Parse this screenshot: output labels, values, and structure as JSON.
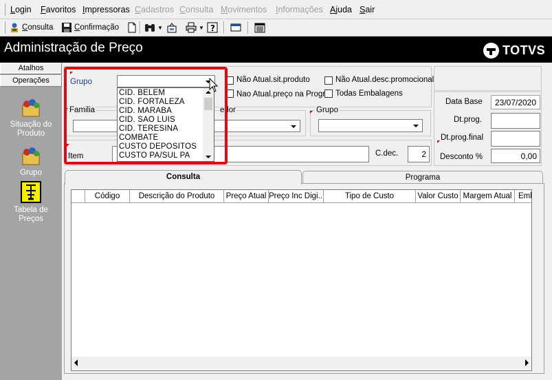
{
  "menu": {
    "items": [
      {
        "label": "Login",
        "ul": "L",
        "rest": "ogin",
        "enabled": true
      },
      {
        "label": "Favoritos",
        "ul": "F",
        "rest": "avoritos",
        "enabled": true
      },
      {
        "label": "Impressoras",
        "ul": "I",
        "rest": "mpressoras",
        "enabled": true
      },
      {
        "label": "Cadastros",
        "ul": "C",
        "rest": "adastros",
        "enabled": false
      },
      {
        "label": "Consulta",
        "ul": "C",
        "rest": "onsulta",
        "enabled": false
      },
      {
        "label": "Movimentos",
        "ul": "M",
        "rest": "ovimentos",
        "enabled": false
      },
      {
        "label": "Informações",
        "ul": "I",
        "rest": "nformações",
        "enabled": false
      },
      {
        "label": "Ajuda",
        "ul": "A",
        "rest": "juda",
        "enabled": true
      },
      {
        "label": "Sair",
        "ul": "S",
        "rest": "air",
        "enabled": true
      }
    ]
  },
  "toolbar": {
    "consulta": {
      "ul": "C",
      "rest": "onsulta"
    },
    "confirmacao": {
      "ul": "C",
      "rest": "onfirmação"
    }
  },
  "window": {
    "title": "Administração de Preço",
    "logo_text": "TOTVS"
  },
  "left_panel": {
    "atalhos": "Atalhos",
    "operacoes": "Operações",
    "items": [
      {
        "line1": "Situação do",
        "line2": "Produto"
      },
      {
        "line1": "Grupo",
        "line2": ""
      },
      {
        "line1": "Tabela de",
        "line2": "Preços"
      }
    ]
  },
  "form": {
    "grupo_label": "Grupo",
    "grupo_value": "",
    "familia_label": "Familia",
    "fornecedor_label_partial": "edor",
    "grupo2_label": "Grupo",
    "item_label": "Item",
    "cdec_label": "C.dec.",
    "cdec_value": "2",
    "checkboxes": [
      {
        "label": "Não Atual.sit.produto",
        "checked": false
      },
      {
        "label": "Nao Atual.preço na Progr.",
        "checked": false
      },
      {
        "label": "Não Atual.desc.promocional",
        "checked": false
      },
      {
        "label": "Todas Embalagens",
        "checked": false
      }
    ],
    "data_base_label": "Data Base",
    "data_base_value": "23/07/2020",
    "dt_prog_label": "Dt.prog.",
    "dt_prog_value": "",
    "dt_prog_final_label": "Dt.prog.final",
    "dt_prog_final_value": "",
    "desconto_label": "Desconto %",
    "desconto_value": "0,00"
  },
  "group_dropdown": {
    "options": [
      "CID. BELEM",
      "CID. FORTALEZA",
      "CID. MARABA",
      "CID. SAO LUIS",
      "CID. TERESINA",
      "COMBATE",
      "CUSTO DEPOSITOS",
      "CUSTO PA/SUL PA"
    ]
  },
  "tabs": {
    "consulta": "Consulta",
    "programa": "Programa"
  },
  "grid": {
    "columns": [
      "",
      "Código",
      "Descrição do Produto",
      "Preço Atual",
      "Preço Inc Digi...",
      "Tipo de Custo",
      "Valor Custo",
      "Margem Atual",
      "Emb"
    ]
  },
  "colors": {
    "highlight": "#e00a14",
    "title_bg": "#000000",
    "left_panel_bg": "#a4a4a4"
  }
}
